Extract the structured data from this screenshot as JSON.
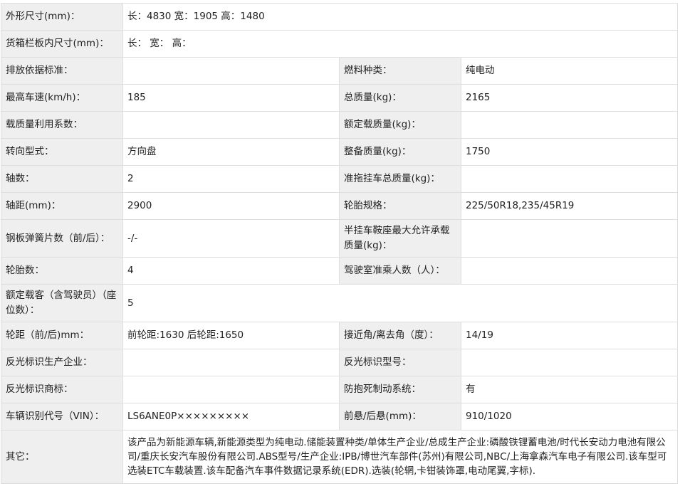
{
  "dimensions": {
    "label": "外形尺寸(mm)：",
    "value": "长：4830 宽：1905 高：1480"
  },
  "cargo_box": {
    "label": "货箱栏板内尺寸(mm)：",
    "value": "长：  宽：  高："
  },
  "rows": [
    {
      "l1": "排放依据标准：",
      "v1": "",
      "l2": "燃料种类：",
      "v2": "纯电动"
    },
    {
      "l1": "最高车速(km/h)：",
      "v1": "185",
      "l2": "总质量(kg)：",
      "v2": "2165"
    },
    {
      "l1": "载质量利用系数：",
      "v1": "",
      "l2": "额定载质量(kg)：",
      "v2": ""
    },
    {
      "l1": "转向型式：",
      "v1": "方向盘",
      "l2": "整备质量(kg)：",
      "v2": "1750"
    },
    {
      "l1": "轴数：",
      "v1": "2",
      "l2": "准拖挂车总质量(kg)：",
      "v2": ""
    },
    {
      "l1": "轴距(mm)：",
      "v1": "2900",
      "l2": "轮胎规格：",
      "v2": "225/50R18,235/45R19"
    },
    {
      "l1": "钢板弹簧片数（前/后）：",
      "v1": "-/-",
      "l2": "半挂车鞍座最大允许承载质量(kg)：",
      "v2": ""
    },
    {
      "l1": "轮胎数：",
      "v1": "4",
      "l2": "驾驶室准乘人数（人）：",
      "v2": ""
    }
  ],
  "passengers": {
    "label": "额定载客（含驾驶员）（座位数）：",
    "value": "5"
  },
  "rows2": [
    {
      "l1": "轮距（前/后)mm：",
      "v1": "前轮距:1630 后轮距:1650",
      "l2": "接近角/离去角（度）：",
      "v2": "14/19"
    },
    {
      "l1": "反光标识生产企业：",
      "v1": "",
      "l2": "反光标识型号：",
      "v2": ""
    },
    {
      "l1": "反光标识商标：",
      "v1": "",
      "l2": "防抱死制动系统：",
      "v2": "有"
    },
    {
      "l1": "车辆识别代号（VIN）：",
      "v1": "LS6ANE0P×××××××××",
      "l2": "前悬/后悬(mm)：",
      "v2": "910/1020"
    }
  ],
  "other": {
    "label": "其它：",
    "value": "该产品为新能源车辆,新能源类型为纯电动.储能装置种类/单体生产企业/总成生产企业:磷酸铁锂蓄电池/时代长安动力电池有限公司/重庆长安汽车股份有限公司.ABS型号/生产企业:IPB/博世汽车部件(苏州)有限公司,NBC/上海拿森汽车电子有限公司.该车型可选装ETC车载装置.该车配备汽车事件数据记录系统(EDR).选装(轮辋,卡钳装饰罩,电动尾翼,字标)."
  }
}
